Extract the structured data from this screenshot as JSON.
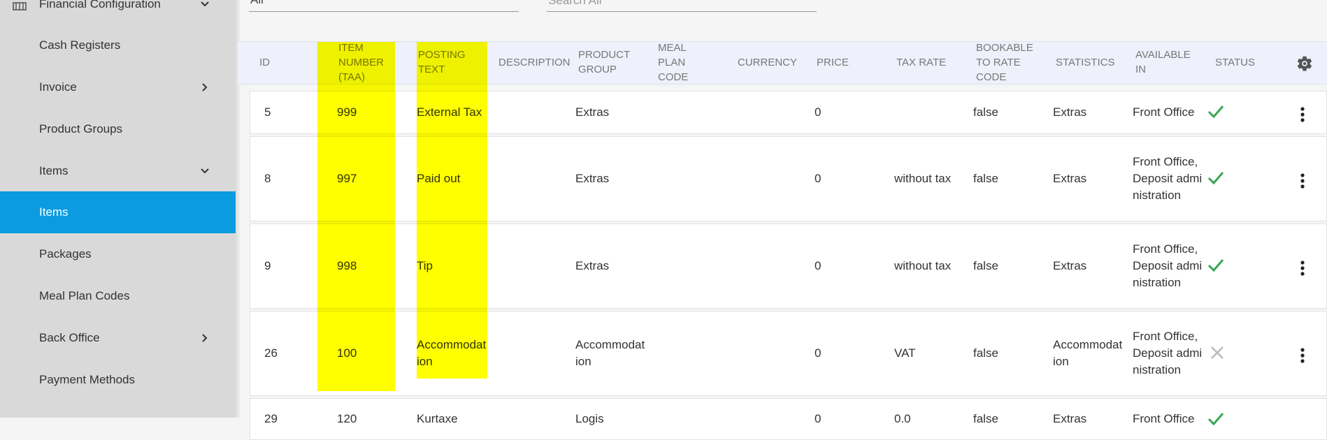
{
  "sidebar": {
    "items": [
      {
        "label": "Financial Configuration",
        "chevron": "chevron-down-icon"
      },
      {
        "label": "Cash Registers"
      },
      {
        "label": "Invoice",
        "chevron": "chevron-right-icon"
      },
      {
        "label": "Product Groups"
      },
      {
        "label": "Items",
        "chevron": "chevron-down-icon"
      },
      {
        "label": "Items",
        "active": true
      },
      {
        "label": "Packages"
      },
      {
        "label": "Meal Plan Codes"
      },
      {
        "label": "Back Office",
        "chevron": "chevron-right-icon"
      },
      {
        "label": "Payment Methods"
      }
    ]
  },
  "filters": {
    "select_value": "All",
    "search_placeholder": "Search All"
  },
  "table": {
    "headers": {
      "id": "ID",
      "item_number": "ITEM NUMBER (TAA)",
      "posting_text": "POSTING TEXT",
      "description": "DESCRIPTION",
      "product_group": "PRODUCT GROUP",
      "meal_plan_code": "MEAL PLAN CODE",
      "currency": "CURRENCY",
      "price": "PRICE",
      "tax_rate": "TAX RATE",
      "bookable": "BOOKABLE TO RATE CODE",
      "statistics": "STATISTICS",
      "available_in": "AVAILABLE IN",
      "status": "STATUS"
    },
    "rows": [
      {
        "id": "5",
        "item_number": "999",
        "posting_text": "External Tax",
        "description": "",
        "product_group": "Extras",
        "meal_plan_code": "",
        "currency": "",
        "price": "0",
        "tax_rate": "",
        "bookable": "false",
        "statistics": "Extras",
        "available_in": "Front Office",
        "status": "active"
      },
      {
        "id": "8",
        "item_number": "997",
        "posting_text": "Paid out",
        "description": "",
        "product_group": "Extras",
        "meal_plan_code": "",
        "currency": "",
        "price": "0",
        "tax_rate": "without tax",
        "bookable": "false",
        "statistics": "Extras",
        "available_in": "Front Office,Deposit administration",
        "status": "active"
      },
      {
        "id": "9",
        "item_number": "998",
        "posting_text": "Tip",
        "description": "",
        "product_group": "Extras",
        "meal_plan_code": "",
        "currency": "",
        "price": "0",
        "tax_rate": "without tax",
        "bookable": "false",
        "statistics": "Extras",
        "available_in": "Front Office,Deposit administration",
        "status": "active"
      },
      {
        "id": "26",
        "item_number": "100",
        "posting_text": "Accommodation",
        "description": "",
        "product_group": "Accommodation",
        "meal_plan_code": "",
        "currency": "",
        "price": "0",
        "tax_rate": "VAT",
        "bookable": "false",
        "statistics": "Accommodation",
        "available_in": "Front Office,Deposit administration",
        "status": "inactive"
      },
      {
        "id": "29",
        "item_number": "120",
        "posting_text": "Kurtaxe",
        "description": "",
        "product_group": "Logis",
        "meal_plan_code": "",
        "currency": "",
        "price": "0",
        "tax_rate": "0.0",
        "bookable": "false",
        "statistics": "Extras",
        "available_in": "Front Office",
        "status": "active"
      }
    ]
  },
  "colors": {
    "accent": "#0b9be0",
    "highlight": "#ffff00",
    "check": "#3aa655",
    "cross": "#bbbbbb"
  }
}
